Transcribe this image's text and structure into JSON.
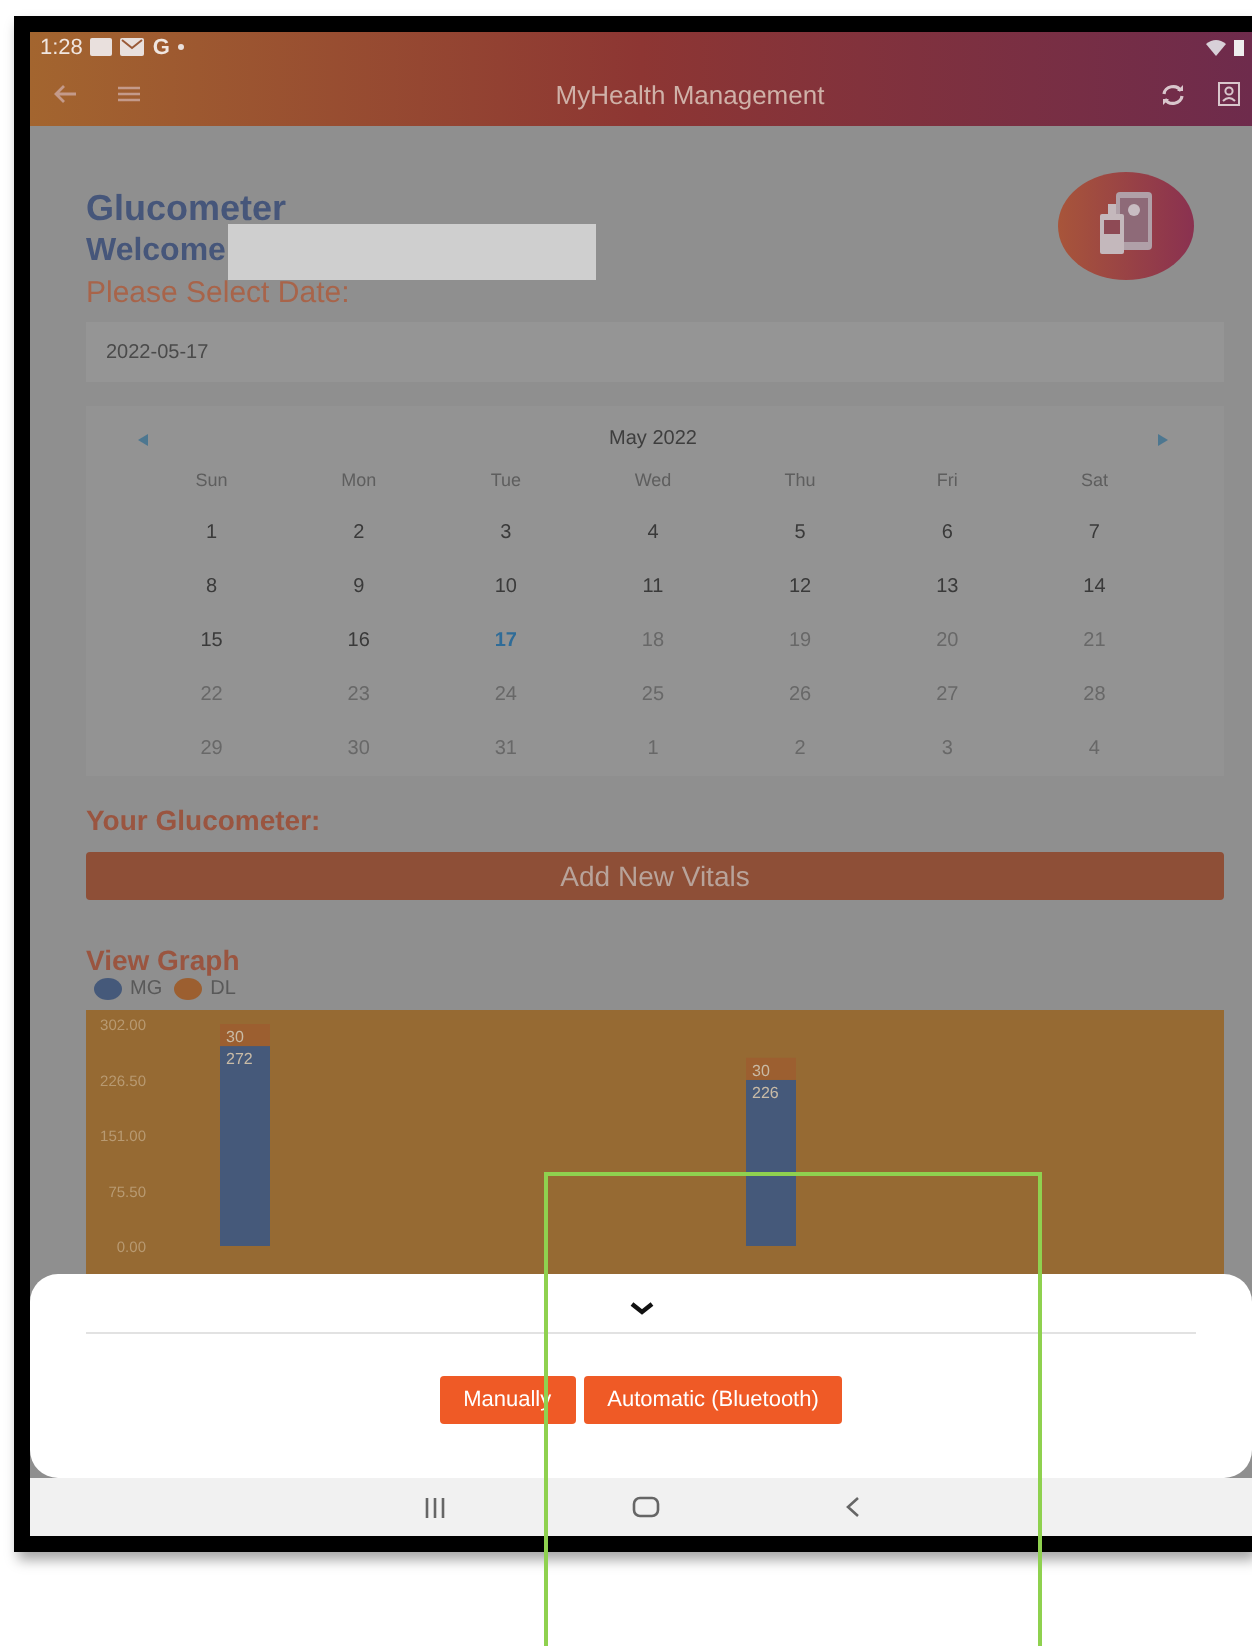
{
  "status_bar": {
    "time": "1:28",
    "app_badge": "G"
  },
  "app_bar": {
    "title": "MyHealth Management"
  },
  "page": {
    "title": "Glucometer",
    "welcome": "Welcome",
    "date_label": "Please Select Date:",
    "date_value": "2022-05-17"
  },
  "calendar": {
    "month": "May 2022",
    "weekdays": [
      "Sun",
      "Mon",
      "Tue",
      "Wed",
      "Thu",
      "Fri",
      "Sat"
    ],
    "days": [
      {
        "label": "1",
        "selected": false,
        "disabled": false
      },
      {
        "label": "2",
        "selected": false,
        "disabled": false
      },
      {
        "label": "3",
        "selected": false,
        "disabled": false
      },
      {
        "label": "4",
        "selected": false,
        "disabled": false
      },
      {
        "label": "5",
        "selected": false,
        "disabled": false
      },
      {
        "label": "6",
        "selected": false,
        "disabled": false
      },
      {
        "label": "7",
        "selected": false,
        "disabled": false
      },
      {
        "label": "8",
        "selected": false,
        "disabled": false
      },
      {
        "label": "9",
        "selected": false,
        "disabled": false
      },
      {
        "label": "10",
        "selected": false,
        "disabled": false
      },
      {
        "label": "11",
        "selected": false,
        "disabled": false
      },
      {
        "label": "12",
        "selected": false,
        "disabled": false
      },
      {
        "label": "13",
        "selected": false,
        "disabled": false
      },
      {
        "label": "14",
        "selected": false,
        "disabled": false
      },
      {
        "label": "15",
        "selected": false,
        "disabled": false
      },
      {
        "label": "16",
        "selected": false,
        "disabled": false
      },
      {
        "label": "17",
        "selected": true,
        "disabled": false
      },
      {
        "label": "18",
        "selected": false,
        "disabled": true
      },
      {
        "label": "19",
        "selected": false,
        "disabled": true
      },
      {
        "label": "20",
        "selected": false,
        "disabled": true
      },
      {
        "label": "21",
        "selected": false,
        "disabled": true
      },
      {
        "label": "22",
        "selected": false,
        "disabled": true
      },
      {
        "label": "23",
        "selected": false,
        "disabled": true
      },
      {
        "label": "24",
        "selected": false,
        "disabled": true
      },
      {
        "label": "25",
        "selected": false,
        "disabled": true
      },
      {
        "label": "26",
        "selected": false,
        "disabled": true
      },
      {
        "label": "27",
        "selected": false,
        "disabled": true
      },
      {
        "label": "28",
        "selected": false,
        "disabled": true
      },
      {
        "label": "29",
        "selected": false,
        "disabled": true
      },
      {
        "label": "30",
        "selected": false,
        "disabled": true
      },
      {
        "label": "31",
        "selected": false,
        "disabled": true
      },
      {
        "label": "1",
        "selected": false,
        "disabled": true
      },
      {
        "label": "2",
        "selected": false,
        "disabled": true
      },
      {
        "label": "3",
        "selected": false,
        "disabled": true
      },
      {
        "label": "4",
        "selected": false,
        "disabled": true
      }
    ]
  },
  "glucometer": {
    "label": "Your Glucometer:",
    "add_button": "Add New Vitals"
  },
  "graph": {
    "title": "View Graph",
    "chart_data": {
      "type": "bar",
      "stacked": true,
      "data_labels": true,
      "ylim": [
        0,
        302
      ],
      "yticks": [
        {
          "value": 0,
          "label": "0.00"
        },
        {
          "value": 75.5,
          "label": "75.50"
        },
        {
          "value": 151,
          "label": "151.00"
        },
        {
          "value": 226.5,
          "label": "226.50"
        },
        {
          "value": 302,
          "label": "302.00"
        }
      ],
      "series": [
        {
          "name": "MG",
          "color": "#45597a",
          "values": [
            272,
            226
          ]
        },
        {
          "name": "DL",
          "color": "#9c5f30",
          "values": [
            30,
            30
          ]
        }
      ]
    }
  },
  "sheet": {
    "buttons": [
      "Manually",
      "Automatic (Bluetooth)"
    ]
  }
}
